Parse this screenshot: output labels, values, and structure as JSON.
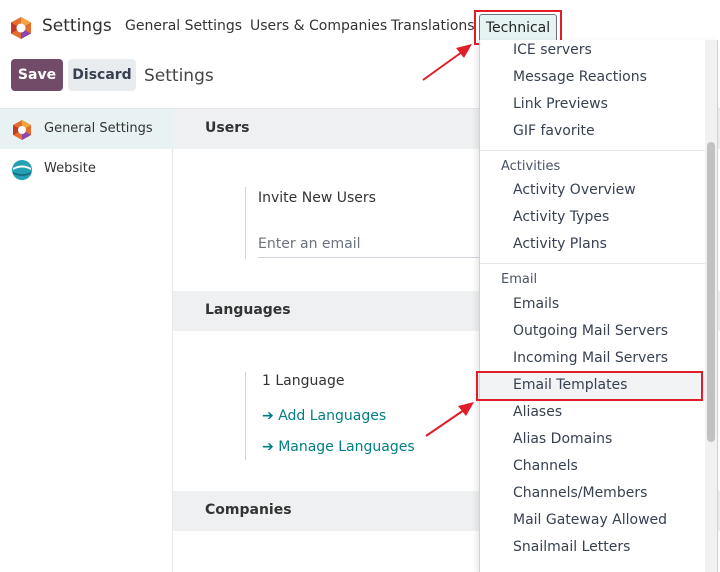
{
  "topbar": {
    "app_name": "Settings",
    "menu": [
      "General Settings",
      "Users & Companies",
      "Translations",
      "Technical"
    ]
  },
  "actions": {
    "save": "Save",
    "discard": "Discard",
    "title": "Settings"
  },
  "sidebar": {
    "items": [
      {
        "label": "General Settings",
        "icon": "odoo-logo-icon"
      },
      {
        "label": "Website",
        "icon": "website-app-icon"
      }
    ]
  },
  "main": {
    "users": {
      "title": "Users",
      "invite_label": "Invite New Users",
      "email_placeholder": "Enter an email"
    },
    "languages": {
      "title": "Languages",
      "count": "1 Language",
      "add": "Add Languages",
      "manage": "Manage Languages"
    },
    "companies": {
      "title": "Companies"
    }
  },
  "dropdown": {
    "items_top": [
      "ICE servers",
      "Message Reactions",
      "Link Previews",
      "GIF favorite"
    ],
    "activities_header": "Activities",
    "activities": [
      "Activity Overview",
      "Activity Types",
      "Activity Plans"
    ],
    "email_header": "Email",
    "email": [
      "Emails",
      "Outgoing Mail Servers",
      "Incoming Mail Servers",
      "Email Templates",
      "Aliases",
      "Alias Domains",
      "Channels",
      "Channels/Members",
      "Mail Gateway Allowed",
      "Snailmail Letters"
    ]
  },
  "colors": {
    "primary": "#714b67",
    "link": "#017e84",
    "highlight": "#e11d2a"
  }
}
